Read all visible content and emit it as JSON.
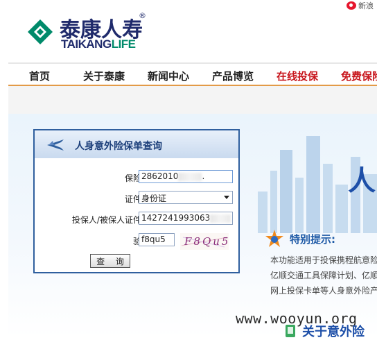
{
  "topbar": {
    "weibo_text": "新浪"
  },
  "logo": {
    "cn": "泰康人寿",
    "reg": "®",
    "en_part1": "TAIKANG",
    "en_part2": "LIFE"
  },
  "nav": {
    "items": [
      {
        "label": "首页"
      },
      {
        "label": "关于泰康"
      },
      {
        "label": "新闻中心"
      },
      {
        "label": "产品博览"
      },
      {
        "label": "在线投保"
      },
      {
        "label": "免费保险"
      }
    ],
    "highlight_color": "#c8161d"
  },
  "banner": {
    "title_fragment": "人"
  },
  "query_form": {
    "title": "人身意外险保单查询",
    "policy_no_label": "保险单号:",
    "policy_no_value": "2862010",
    "policy_no_tail": ".",
    "id_type_label": "证件类型:",
    "id_type_value": "身份证",
    "id_no_label": "投保人/被保人证件号码:",
    "id_no_value": "1427241993063",
    "captcha_label": "验证码:",
    "captcha_value": "f8qu5",
    "captcha_image_text": "F8Qu5",
    "submit_label": "查 询"
  },
  "notice": {
    "title": "特别提示:",
    "lines": [
      "本功能适用于投保携程航意险",
      "亿顺交通工具保障计划、亿顺",
      "网上投保卡单等人身意外险产"
    ]
  },
  "watermark": "www.wooyun.org",
  "bottom_link": {
    "label": "关于意外险"
  },
  "colors": {
    "brand_navy": "#1f2a6b",
    "brand_green": "#008a6a",
    "nav_underline": "#e39a47",
    "panel_border": "#2f5f9e"
  }
}
